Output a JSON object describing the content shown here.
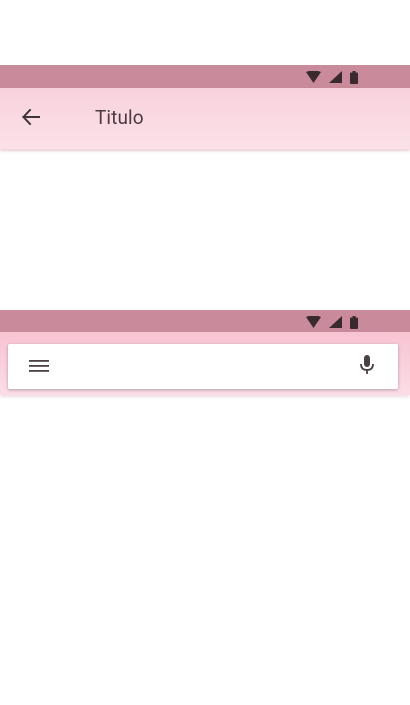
{
  "status_bar_top": {
    "icons": [
      "wifi-icon",
      "signal-icon",
      "battery-icon"
    ]
  },
  "app_bar": {
    "back_icon": "arrow-left-icon",
    "title": "Titulo"
  },
  "status_bar_bottom": {
    "icons": [
      "wifi-icon",
      "signal-icon",
      "battery-icon"
    ]
  },
  "search_bar": {
    "menu_icon": "menu-icon",
    "mic_icon": "microphone-icon",
    "query": ""
  },
  "colors": {
    "status_bar": "#c98a9b",
    "app_bar": "#f8d2dd",
    "search_area": "#f7c3d2",
    "title_text": "#4a3a42",
    "icon": "#3d3338"
  }
}
